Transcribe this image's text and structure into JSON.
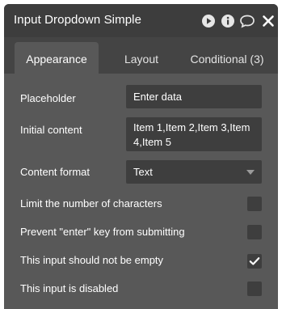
{
  "header": {
    "title": "Input Dropdown Simple",
    "icons": [
      "play-icon",
      "info-icon",
      "comment-icon",
      "close-icon"
    ]
  },
  "tabs": [
    {
      "label": "Appearance",
      "active": true
    },
    {
      "label": "Layout",
      "active": false
    },
    {
      "label": "Conditional (3)",
      "active": false
    }
  ],
  "fields": {
    "placeholder": {
      "label": "Placeholder",
      "value": "Enter data"
    },
    "initial_content": {
      "label": "Initial content",
      "value": "Item 1,Item 2,Item 3,Item 4,Item 5"
    },
    "content_format": {
      "label": "Content format",
      "value": "Text"
    }
  },
  "options": [
    {
      "label": "Limit the number of characters",
      "checked": false
    },
    {
      "label": "Prevent \"enter\" key from submitting",
      "checked": false
    },
    {
      "label": "This input should not be empty",
      "checked": true
    },
    {
      "label": "This input is disabled",
      "checked": false
    }
  ],
  "colors": {
    "header_bg": "#3d3d3d",
    "panel_bg": "#444444",
    "content_bg": "#585858",
    "field_bg": "#3e3e3e",
    "text": "#ffffff"
  }
}
